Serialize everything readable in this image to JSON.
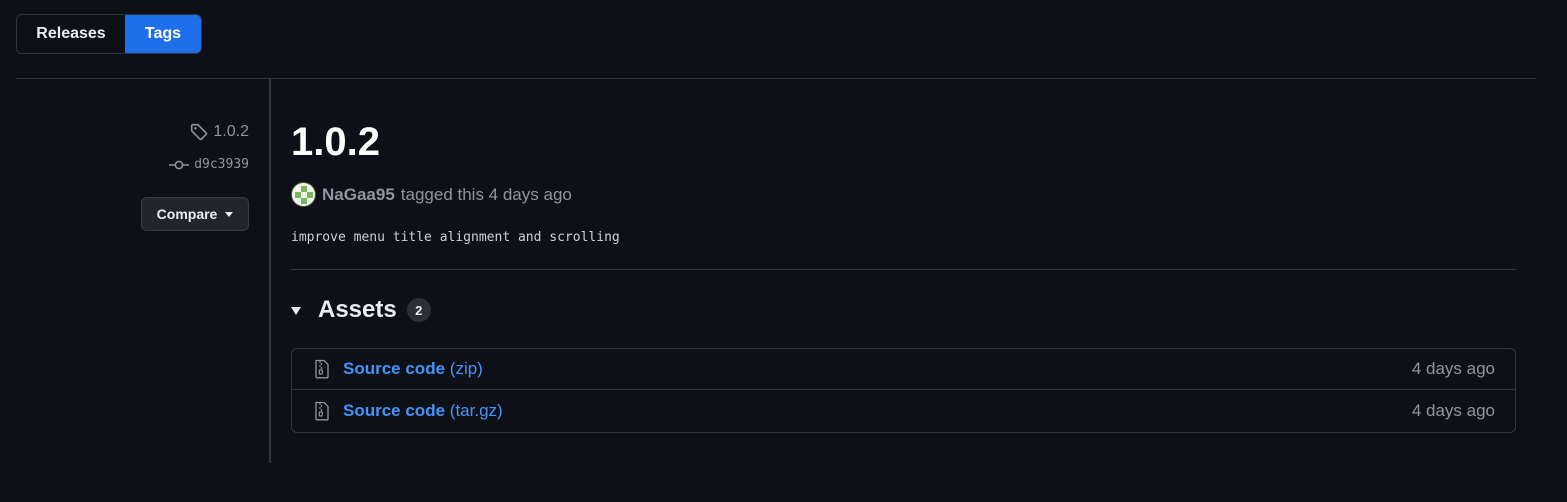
{
  "nav": {
    "releases_label": "Releases",
    "tags_label": "Tags",
    "active": "Tags"
  },
  "sidebar": {
    "tag_icon": "tag-icon",
    "tag_name": "1.0.2",
    "commit_icon": "git-commit-icon",
    "commit_sha": "d9c3939",
    "compare_label": "Compare"
  },
  "release": {
    "title": "1.0.2",
    "author": "NaGaa95",
    "tagged_text": "tagged this 4 days ago",
    "message": "improve menu title alignment and scrolling"
  },
  "assets": {
    "label": "Assets",
    "count": "2",
    "items": [
      {
        "icon": "file-zip-icon",
        "name": "Source code",
        "ext": "(zip)",
        "date": "4 days ago"
      },
      {
        "icon": "file-zip-icon",
        "name": "Source code",
        "ext": "(tar.gz)",
        "date": "4 days ago"
      }
    ]
  },
  "colors": {
    "background": "#0d1117",
    "accent": "#1f6feb",
    "link": "#4493f8",
    "border": "#30363d",
    "muted": "#8d96a0"
  }
}
